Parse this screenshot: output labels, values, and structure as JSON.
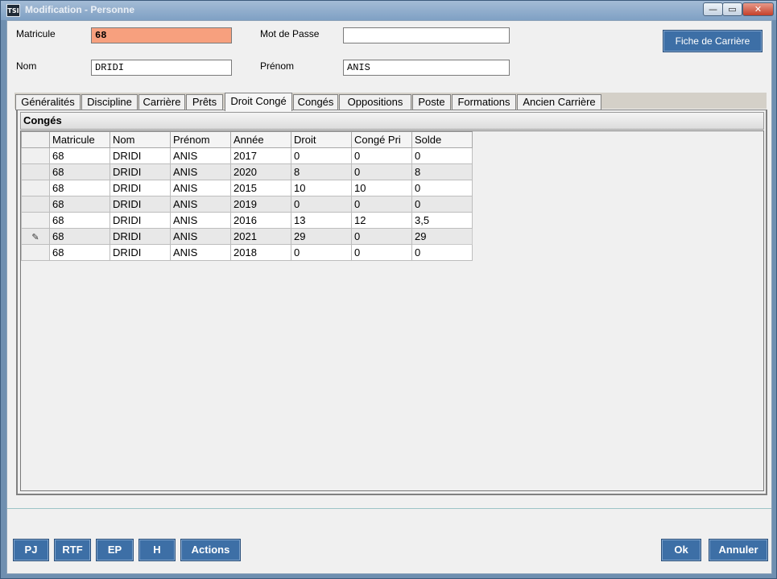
{
  "window": {
    "title": "Modification - Personne",
    "logo_text": "TSI",
    "controls": {
      "minimize": "—",
      "maximize": "▭",
      "close": "✕"
    }
  },
  "form": {
    "matricule_label": "Matricule",
    "matricule_value": "68",
    "motdepasse_label": "Mot de Passe",
    "motdepasse_value": "",
    "nom_label": "Nom",
    "nom_value": "DRIDI",
    "prenom_label": "Prénom",
    "prenom_value": "ANIS",
    "fiche_button": "Fiche de Carrière",
    "matricule_color": "#f7a07e"
  },
  "tabs": [
    {
      "label": "Généralités"
    },
    {
      "label": "Discipline"
    },
    {
      "label": "Carrière"
    },
    {
      "label": "Prêts"
    },
    {
      "label": "Droit Congé"
    },
    {
      "label": "Congés"
    },
    {
      "label": "Oppositions"
    },
    {
      "label": "Poste"
    },
    {
      "label": "Formations"
    },
    {
      "label": "Ancien Carrière"
    }
  ],
  "active_tab": "Droit Congé",
  "group": {
    "title": "Congés"
  },
  "grid": {
    "columns": [
      "Matricule",
      "Nom",
      "Prénom",
      "Année",
      "Droit",
      "Congé Pri",
      "Solde"
    ],
    "rows": [
      [
        "68",
        "DRIDI",
        "ANIS",
        "2017",
        "0",
        "0",
        "0"
      ],
      [
        "68",
        "DRIDI",
        "ANIS",
        "2020",
        "8",
        "0",
        "8"
      ],
      [
        "68",
        "DRIDI",
        "ANIS",
        "2015",
        "10",
        "10",
        "0"
      ],
      [
        "68",
        "DRIDI",
        "ANIS",
        "2019",
        "0",
        "0",
        "0"
      ],
      [
        "68",
        "DRIDI",
        "ANIS",
        "2016",
        "13",
        "12",
        "3,5"
      ],
      [
        "68",
        "DRIDI",
        "ANIS",
        "2021",
        "29",
        "0",
        "29"
      ],
      [
        "68",
        "DRIDI",
        "ANIS",
        "2018",
        "0",
        "0",
        "0"
      ]
    ],
    "editing_row_index": 5,
    "edit_icon": "pencil-icon"
  },
  "footer": {
    "pj": "PJ",
    "rtf": "RTF",
    "ep": "EP",
    "h": "H",
    "actions": "Actions",
    "ok": "Ok",
    "annuler": "Annuler"
  },
  "colors": {
    "button_blue": "#3d6fa6",
    "title_bar": "#7fa0c4"
  }
}
